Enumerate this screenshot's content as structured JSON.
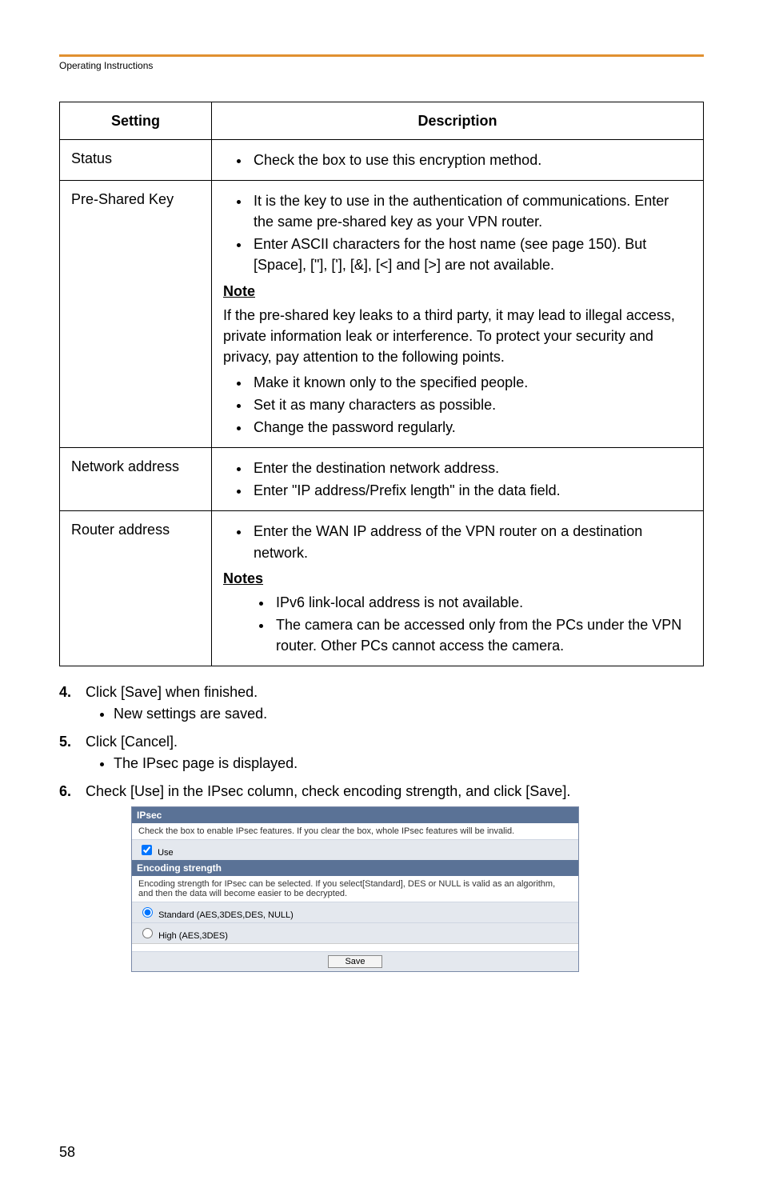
{
  "header": {
    "label": "Operating Instructions"
  },
  "table": {
    "cols": {
      "setting": "Setting",
      "description": "Description"
    },
    "rows": {
      "status": {
        "label": "Status",
        "bullets": [
          "Check the box to use this encryption method."
        ]
      },
      "psk": {
        "label": "Pre-Shared Key",
        "bullets1": [
          "It is the key to use in the authentication of communications. Enter the same pre-shared key as your VPN router.",
          "Enter ASCII characters for the host name (see page 150). But [Space], [\"], ['], [&], [<] and [>] are not available."
        ],
        "note_label": "Note",
        "note_p": "If the pre-shared key leaks to a third party, it may lead to illegal access, private information leak or interference. To protect your security and privacy, pay attention to the following points.",
        "bullets2": [
          "Make it known only to the specified people.",
          "Set it as many characters as possible.",
          "Change the password regularly."
        ]
      },
      "net": {
        "label": "Network address",
        "bullets": [
          "Enter the destination network address.",
          "Enter \"IP address/Prefix length\" in the data field."
        ]
      },
      "router": {
        "label": "Router address",
        "bullets1": [
          "Enter the WAN IP address of the VPN router on a destination network."
        ],
        "note_label": "Notes",
        "bullets2": [
          "IPv6 link-local address is not available.",
          "The camera can be accessed only from the PCs under the VPN router. Other PCs cannot access the camera."
        ]
      }
    }
  },
  "steps": {
    "s4": {
      "num": "4.",
      "text": "Click [Save] when finished.",
      "sub": [
        "New settings are saved."
      ]
    },
    "s5": {
      "num": "5.",
      "text": "Click [Cancel].",
      "sub": [
        "The IPsec page is displayed."
      ]
    },
    "s6": {
      "num": "6.",
      "text": "Check [Use] in the IPsec column, check encoding strength, and click [Save]."
    }
  },
  "shot": {
    "ipsec_bar": "IPsec",
    "ipsec_note": "Check the box to enable IPsec features. If you clear the box, whole IPsec features will be invalid.",
    "use_label": "Use",
    "enc_bar": "Encoding strength",
    "enc_note": "Encoding strength for IPsec can be selected. If you select[Standard], DES or NULL is valid as an algorithm, and then the data will become easier to be decrypted.",
    "opt_standard": "Standard (AES,3DES,DES, NULL)",
    "opt_high": "High (AES,3DES)",
    "save_btn": "Save"
  },
  "page_number": "58"
}
